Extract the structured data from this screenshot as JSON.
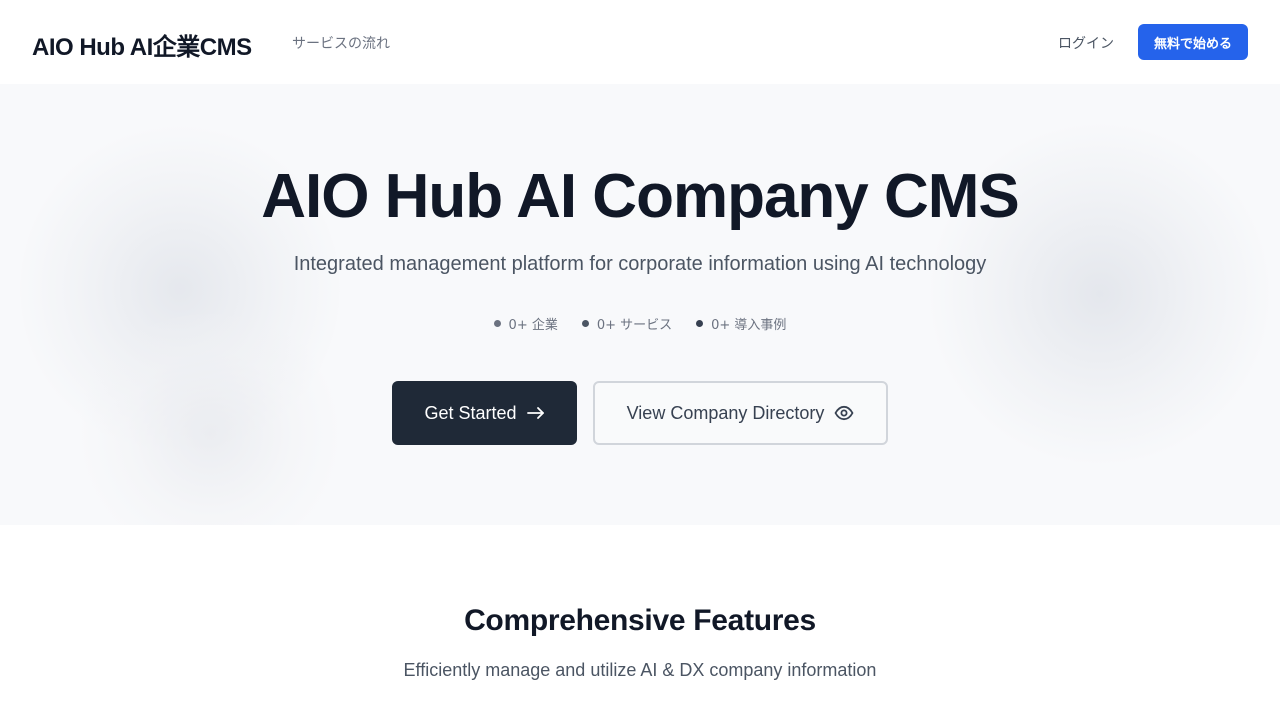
{
  "header": {
    "brand": "AIO Hub AI企業CMS",
    "nav_link": "サービスの流れ",
    "login": "ログイン",
    "signup": "無料で始める"
  },
  "hero": {
    "title": "AIO Hub AI Company CMS",
    "subtitle": "Integrated management platform for corporate information using AI technology",
    "stats": [
      {
        "label": "0+ 企業",
        "color": "#6b7280"
      },
      {
        "label": "0+ サービス",
        "color": "#4b5563"
      },
      {
        "label": "0+ 導入事例",
        "color": "#374151"
      }
    ],
    "primary_button": "Get Started",
    "secondary_button": "View Company Directory"
  },
  "features": {
    "title": "Comprehensive Features",
    "subtitle": "Efficiently manage and utilize AI & DX company information"
  },
  "colors": {
    "accent": "#2563eb",
    "dark_button": "#1f2937",
    "hero_bg": "#f8f9fb"
  },
  "icons": {
    "primary_button_icon": "arrow-right-icon",
    "secondary_button_icon": "eye-icon"
  }
}
